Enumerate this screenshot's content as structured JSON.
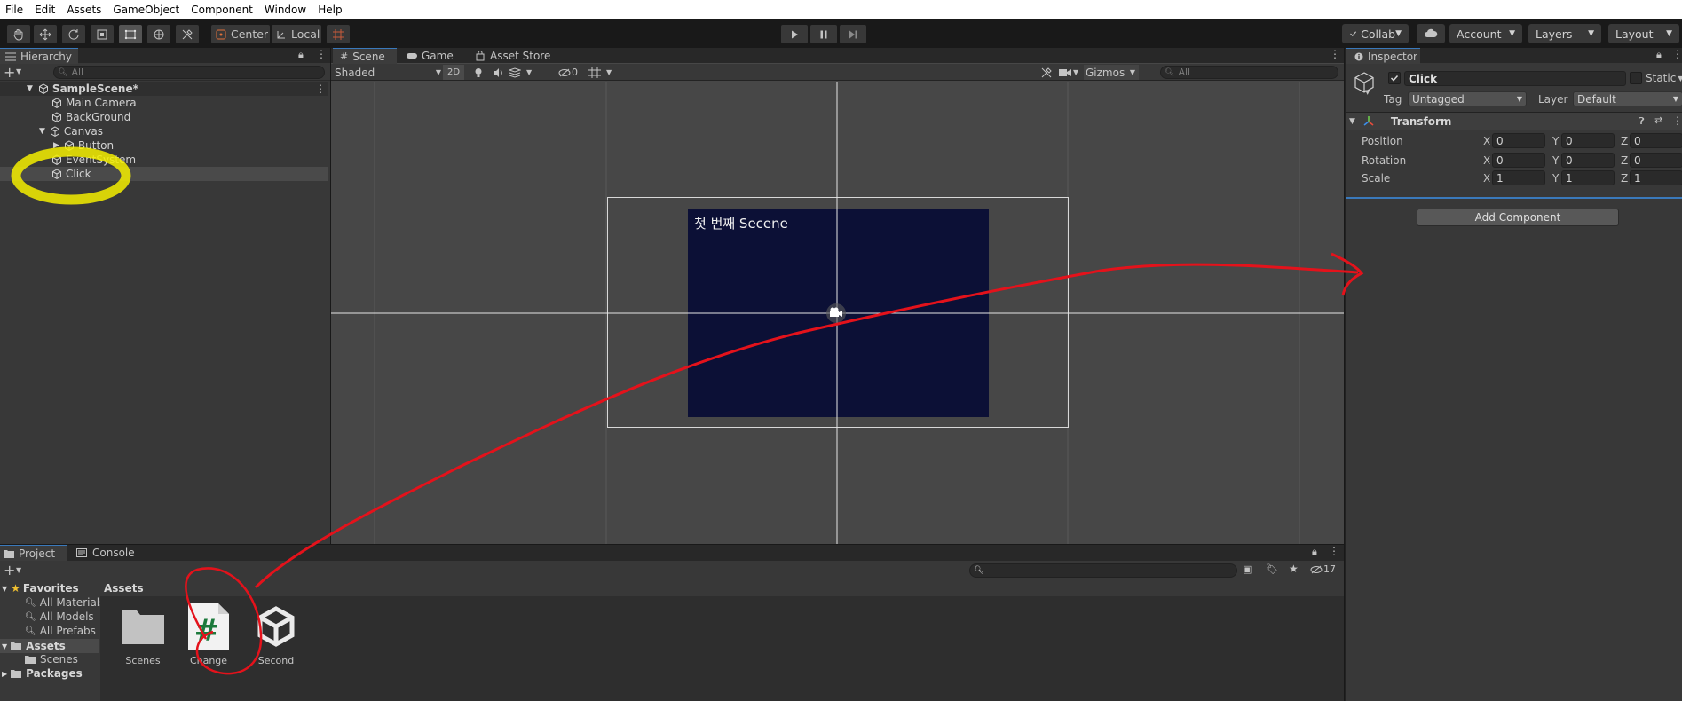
{
  "menu": {
    "items": [
      "File",
      "Edit",
      "Assets",
      "GameObject",
      "Component",
      "Window",
      "Help"
    ]
  },
  "toolbar": {
    "pivot_label": "Center",
    "space_label": "Local",
    "collab_label": "Collab",
    "account_label": "Account",
    "layers_label": "Layers",
    "layout_label": "Layout"
  },
  "hierarchy": {
    "tab_label": "Hierarchy",
    "search_placeholder": "All",
    "scene_name": "SampleScene*",
    "items": [
      "Main Camera",
      "BackGround",
      "Canvas",
      "Button",
      "EventSystem",
      "Click"
    ]
  },
  "scene": {
    "tabs": [
      "Scene",
      "Game",
      "Asset Store"
    ],
    "shading_mode": "Shaded",
    "mode_2d": "2D",
    "hidden_count": "0",
    "gizmos_label": "Gizmos",
    "search_placeholder": "All",
    "canvas_text": "첫 번째 Secene"
  },
  "inspector": {
    "tab_label": "Inspector",
    "object_name": "Click",
    "static_label": "Static",
    "tag_label": "Tag",
    "tag_value": "Untagged",
    "layer_label": "Layer",
    "layer_value": "Default",
    "component_name": "Transform",
    "rows": [
      {
        "label": "Position",
        "x": "0",
        "y": "0",
        "z": "0"
      },
      {
        "label": "Rotation",
        "x": "0",
        "y": "0",
        "z": "0"
      },
      {
        "label": "Scale",
        "x": "1",
        "y": "1",
        "z": "1"
      }
    ],
    "axis_x": "X",
    "axis_y": "Y",
    "axis_z": "Z",
    "add_component_label": "Add Component"
  },
  "project": {
    "tabs": [
      "Project",
      "Console"
    ],
    "hidden_count": "17",
    "favorites_label": "Favorites",
    "favorites": [
      "All Materials",
      "All Models",
      "All Prefabs"
    ],
    "assets_label": "Assets",
    "assets_children": [
      "Scenes"
    ],
    "packages_label": "Packages",
    "breadcrumb": "Assets",
    "asset_items": [
      {
        "name": "Scenes",
        "icon": "folder-icon"
      },
      {
        "name": "Change",
        "icon": "csharp-script-icon"
      },
      {
        "name": "Second",
        "icon": "unity-scene-icon"
      }
    ]
  },
  "colors": {
    "accent": "#3a79bb",
    "canvas_bg": "#0c1036",
    "annotation_red": "#e4121b",
    "annotation_yellow": "#f4ef00"
  }
}
